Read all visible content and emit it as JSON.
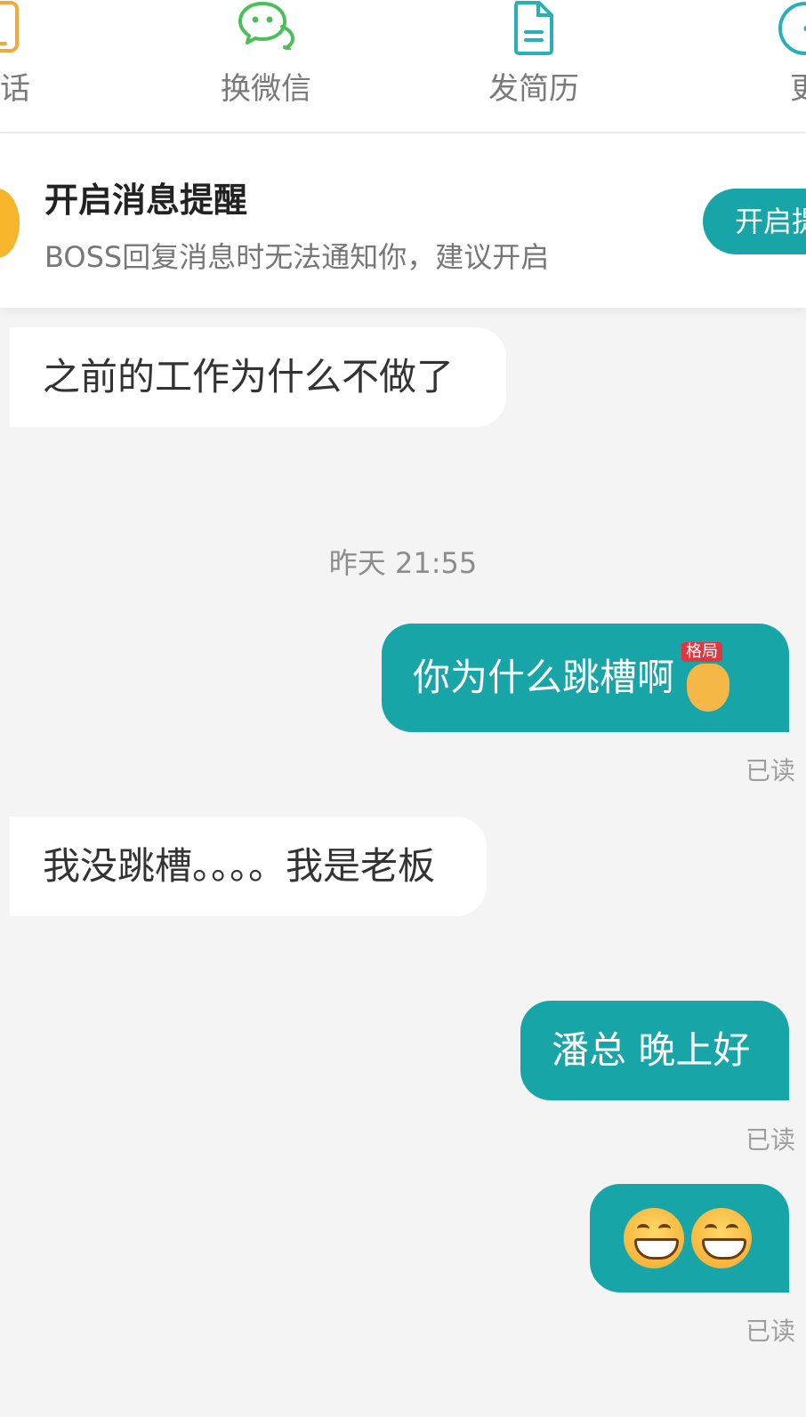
{
  "top_actions": [
    {
      "label": "电话",
      "icon": "phone-icon",
      "color": "#f0a93b"
    },
    {
      "label": "换微信",
      "icon": "wechat-icon",
      "color": "#4cbf5a"
    },
    {
      "label": "发简历",
      "icon": "resume-icon",
      "color": "#27b0b5"
    },
    {
      "label": "更",
      "icon": "more-icon",
      "color": "#27b0b5"
    }
  ],
  "banner": {
    "title": "开启消息提醒",
    "description": "BOSS回复消息时无法通知你，建议开启",
    "button": "开启提醒",
    "icon": "bell-icon"
  },
  "chat": {
    "msg1": "之前的工作为什么不做了",
    "timestamp": "昨天 21:55",
    "msg2": "你为什么跳槽啊",
    "msg2_emoji_tag": "格局",
    "msg3": "我没跳槽。。。。我是老板",
    "msg4": "潘总 晚上好",
    "read_label": "已读"
  },
  "colors": {
    "accent": "#18a5a7",
    "background": "#f4f4f5"
  }
}
